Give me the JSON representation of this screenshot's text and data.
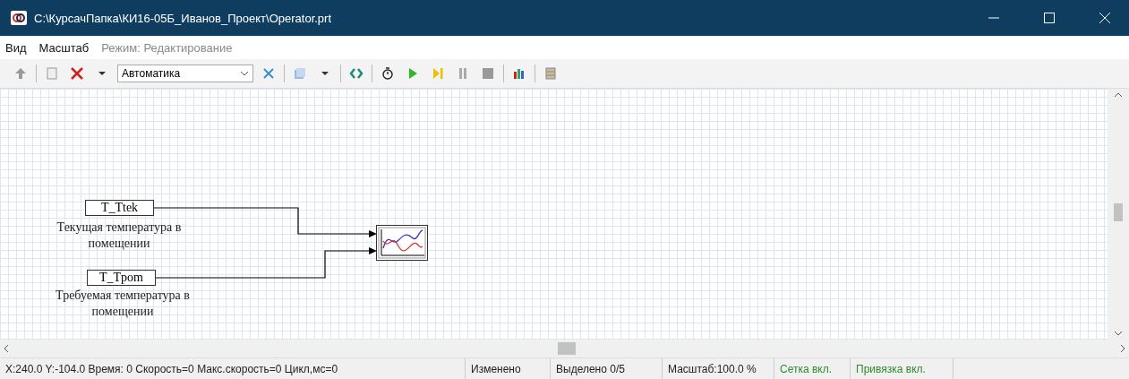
{
  "window": {
    "title": "C:\\КурсачПапка\\КИ16-05Б_Иванов_Проект\\Operator.prt"
  },
  "menu": [
    {
      "label": "Вид",
      "disabled": false
    },
    {
      "label": "Масштаб",
      "disabled": false
    },
    {
      "label": "Режим: Редактирование",
      "disabled": true
    }
  ],
  "toolbar": {
    "mode_select": {
      "value": "Автоматика"
    }
  },
  "canvas": {
    "tags": [
      {
        "label": "T_Ttek",
        "caption": "Текущая температура в помещении"
      },
      {
        "label": "T_Tpom",
        "caption": "Требуемая температура в помещении"
      }
    ]
  },
  "status_bar": [
    {
      "text": "X:240.0  Y:-104.0 Время: 0 Скорость=0 Макс.скорость=0 Цикл,мс=0",
      "color": "#222222"
    },
    {
      "text": "Изменено",
      "color": "#222222"
    },
    {
      "text": "Выделено 0/5",
      "color": "#222222"
    },
    {
      "text": "Масштаб:100.0 %",
      "color": "#222222"
    },
    {
      "text": "Сетка вкл.",
      "color": "#2e8b2e"
    },
    {
      "text": "Привязка вкл.",
      "color": "#2e8b2e"
    }
  ]
}
